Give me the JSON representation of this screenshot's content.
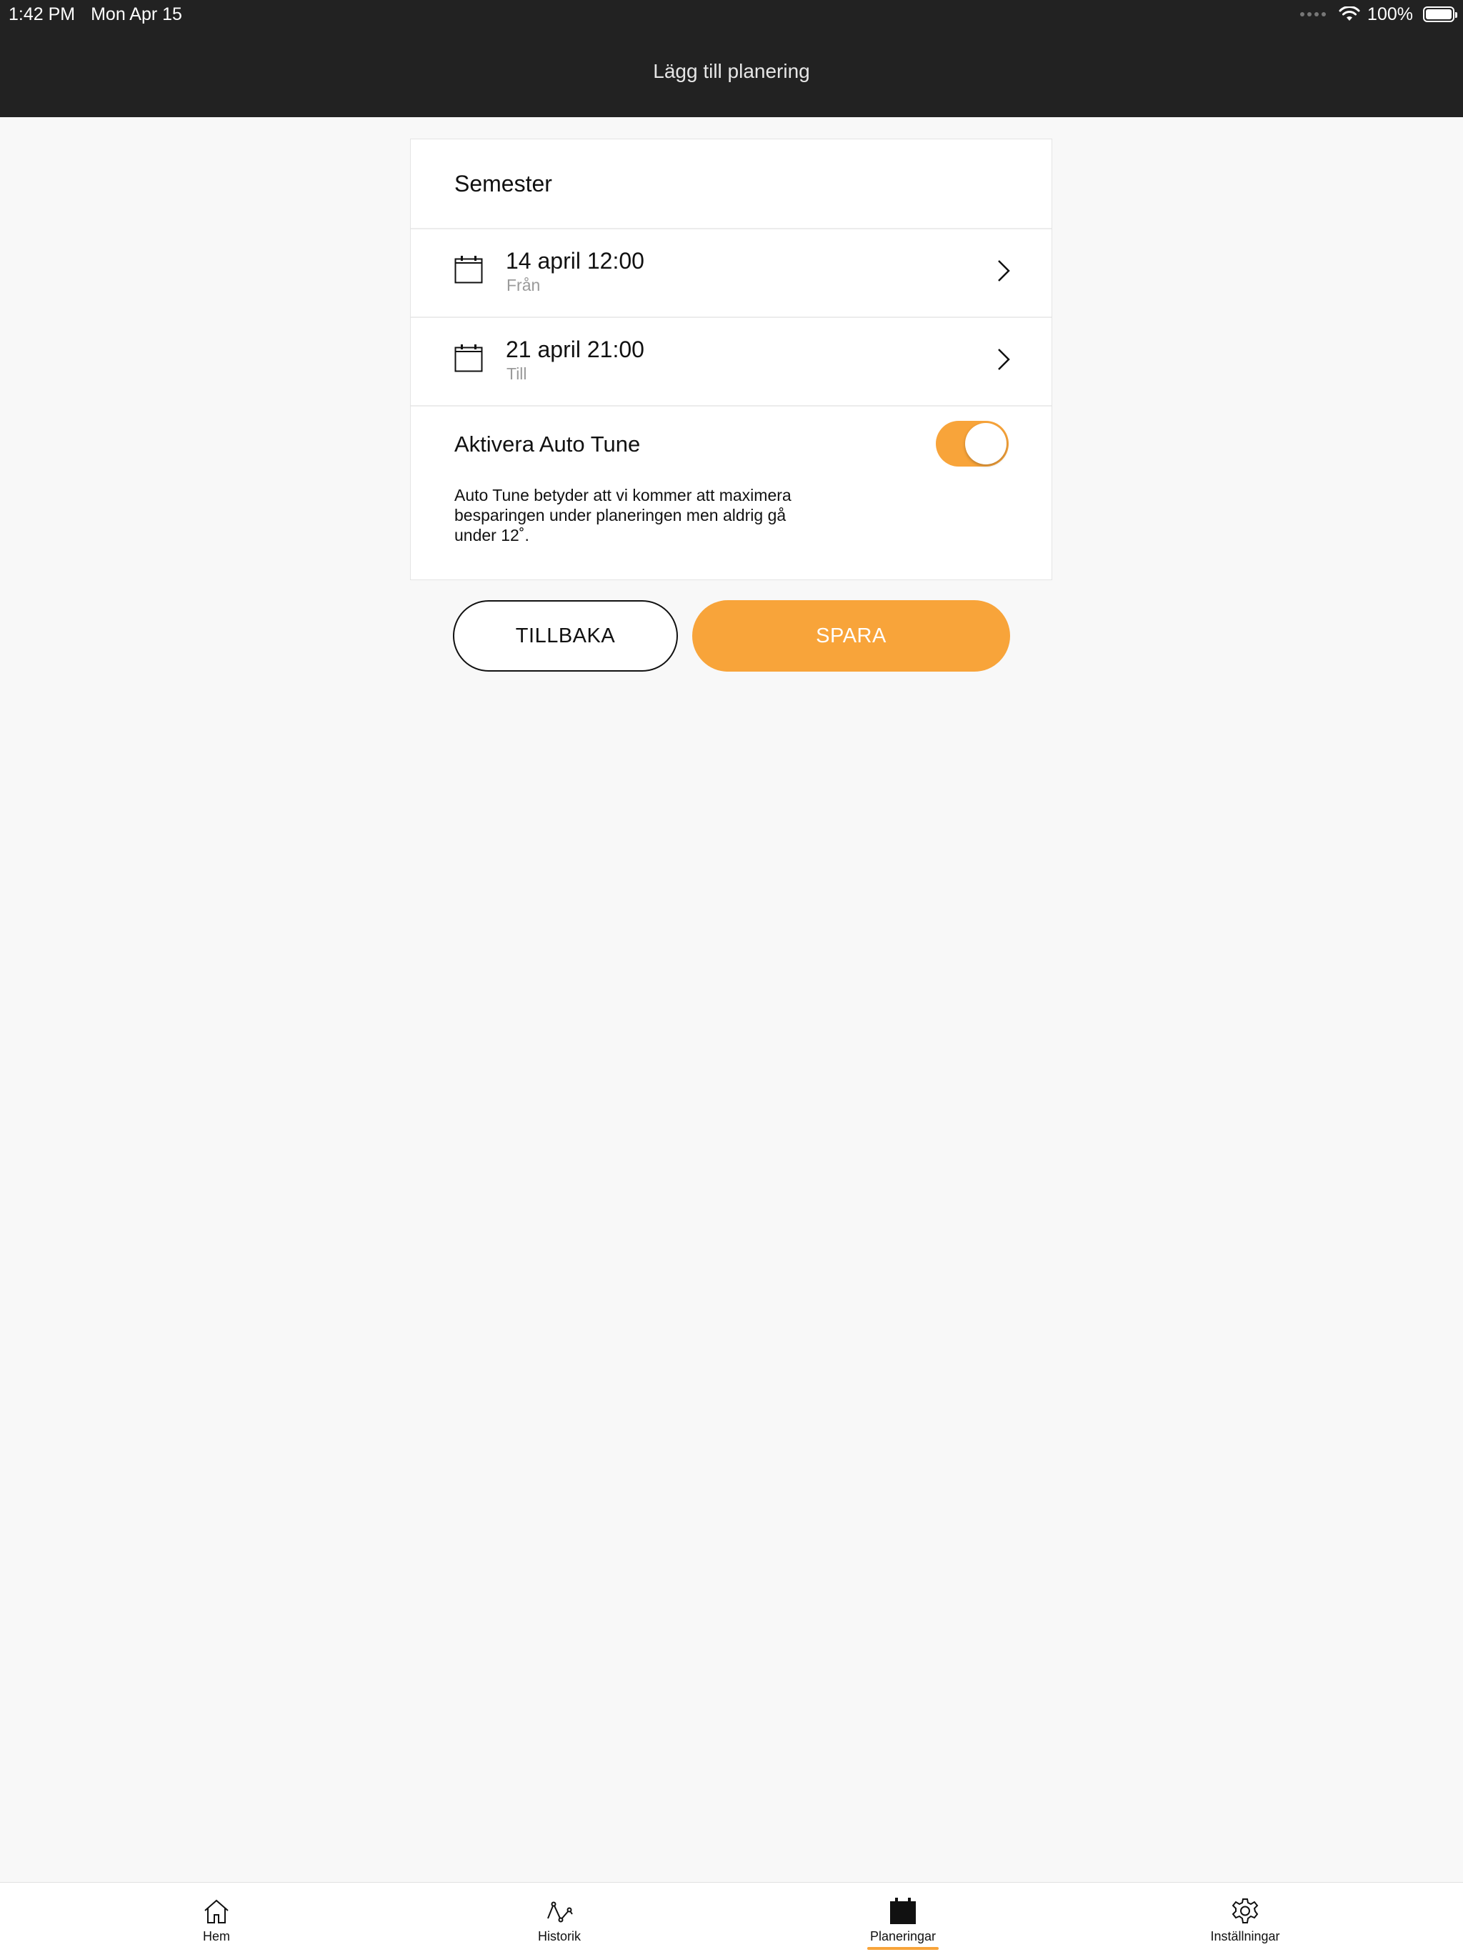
{
  "status_bar": {
    "time": "1:42 PM",
    "date": "Mon Apr 15",
    "battery": "100%"
  },
  "header": {
    "title": "Lägg till planering"
  },
  "form": {
    "name": "Semester",
    "from": {
      "value": "14 april 12:00",
      "label": "Från"
    },
    "to": {
      "value": "21 april 21:00",
      "label": "Till"
    },
    "auto_tune": {
      "label": "Aktivera Auto Tune",
      "enabled": true,
      "description": "Auto Tune betyder att vi kommer att maximera besparingen under planeringen men aldrig gå under 12˚."
    }
  },
  "actions": {
    "back_label": "TILLBAKA",
    "save_label": "SPARA"
  },
  "tabbar": {
    "items": [
      {
        "label": "Hem",
        "icon": "home-icon",
        "active": false
      },
      {
        "label": "Historik",
        "icon": "graph-icon",
        "active": false
      },
      {
        "label": "Planeringar",
        "icon": "calendar-icon",
        "active": true
      },
      {
        "label": "Inställningar",
        "icon": "gear-icon",
        "active": false
      }
    ]
  },
  "colors": {
    "accent": "#f8a43a",
    "header_bg": "#222222",
    "page_bg": "#f8f8f8"
  }
}
